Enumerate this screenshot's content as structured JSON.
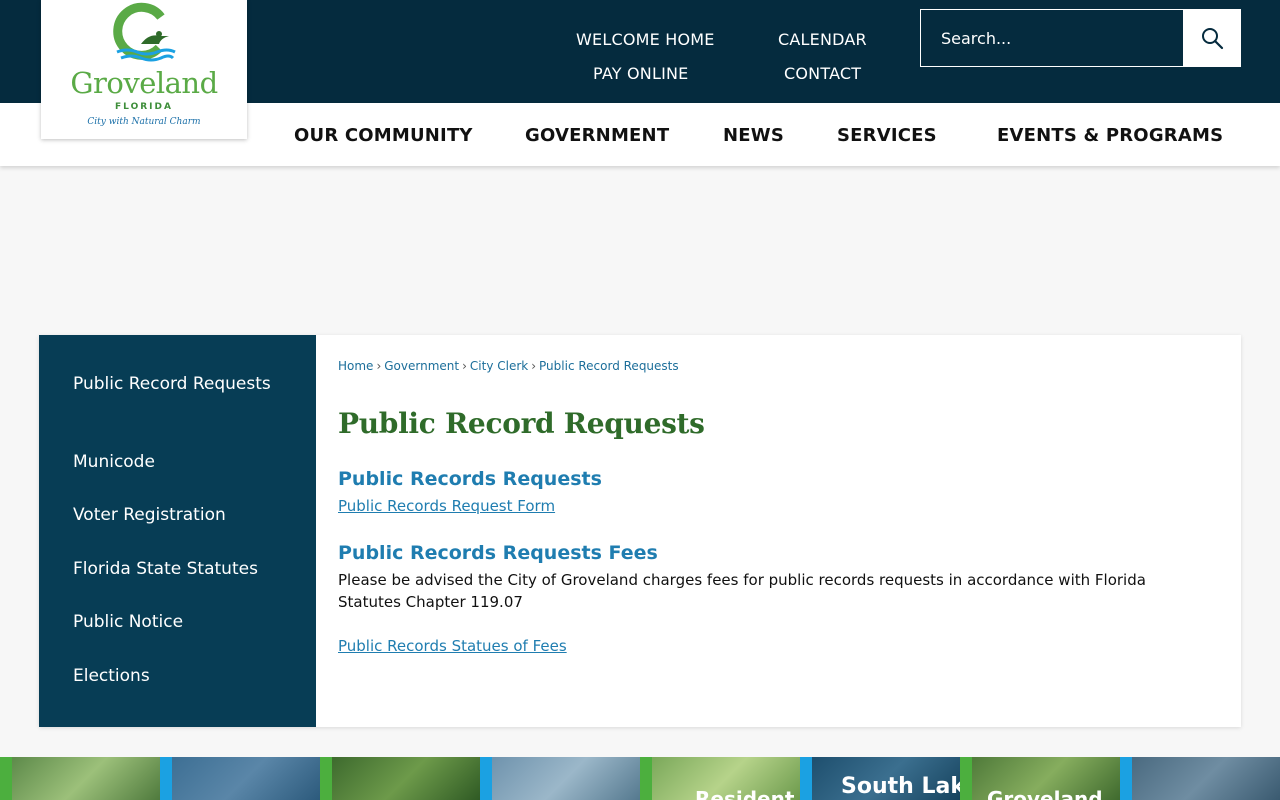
{
  "logo": {
    "title": "Groveland",
    "subtitle": "FLORIDA",
    "tagline": "City with Natural Charm"
  },
  "utility_nav": {
    "welcome_home": "WELCOME HOME",
    "calendar": "CALENDAR",
    "pay_online": "PAY ONLINE",
    "contact": "CONTACT"
  },
  "search": {
    "placeholder": "Search..."
  },
  "main_nav": {
    "items": [
      "OUR COMMUNITY",
      "GOVERNMENT",
      "NEWS",
      "SERVICES",
      "EVENTS & PROGRAMS"
    ]
  },
  "sidebar": {
    "items": [
      {
        "label": "Public Record Requests"
      },
      {
        "label": "Municode"
      },
      {
        "label": "Voter Registration"
      },
      {
        "label": "Florida State Statutes"
      },
      {
        "label": "Public Notice"
      },
      {
        "label": "Elections"
      }
    ]
  },
  "breadcrumb": {
    "items": [
      "Home",
      "Government",
      "City Clerk",
      "Public Record Requests"
    ],
    "separator": "›"
  },
  "content": {
    "page_title": "Public Record Requests",
    "section1_heading": "Public Records Requests",
    "section1_link": "Public Records Request Form",
    "section2_heading": "Public Records Requests Fees",
    "section2_text": "Please be advised the City of Groveland charges fees for public records requests in accordance with Florida Statutes Chapter 119.07",
    "section2_link": "Public Records Statues of Fees"
  },
  "tiles": {
    "items": [
      {
        "title": ""
      },
      {
        "title": ""
      },
      {
        "title": ""
      },
      {
        "title": ""
      },
      {
        "title": "Resident"
      },
      {
        "title": "South Lak"
      },
      {
        "title": "Groveland"
      },
      {
        "title": ""
      }
    ]
  },
  "colors": {
    "top_bar": "#052b3e",
    "sidebar": "#073d55",
    "title_green": "#2f6b2a",
    "link_blue": "#1f7db0",
    "logo_green": "#5aaa46",
    "tile_green": "#4caf3e",
    "tile_blue": "#1ba1e2"
  },
  "icons": {
    "search": "search-icon",
    "logo_mark": "groveland-g-logo-icon"
  }
}
